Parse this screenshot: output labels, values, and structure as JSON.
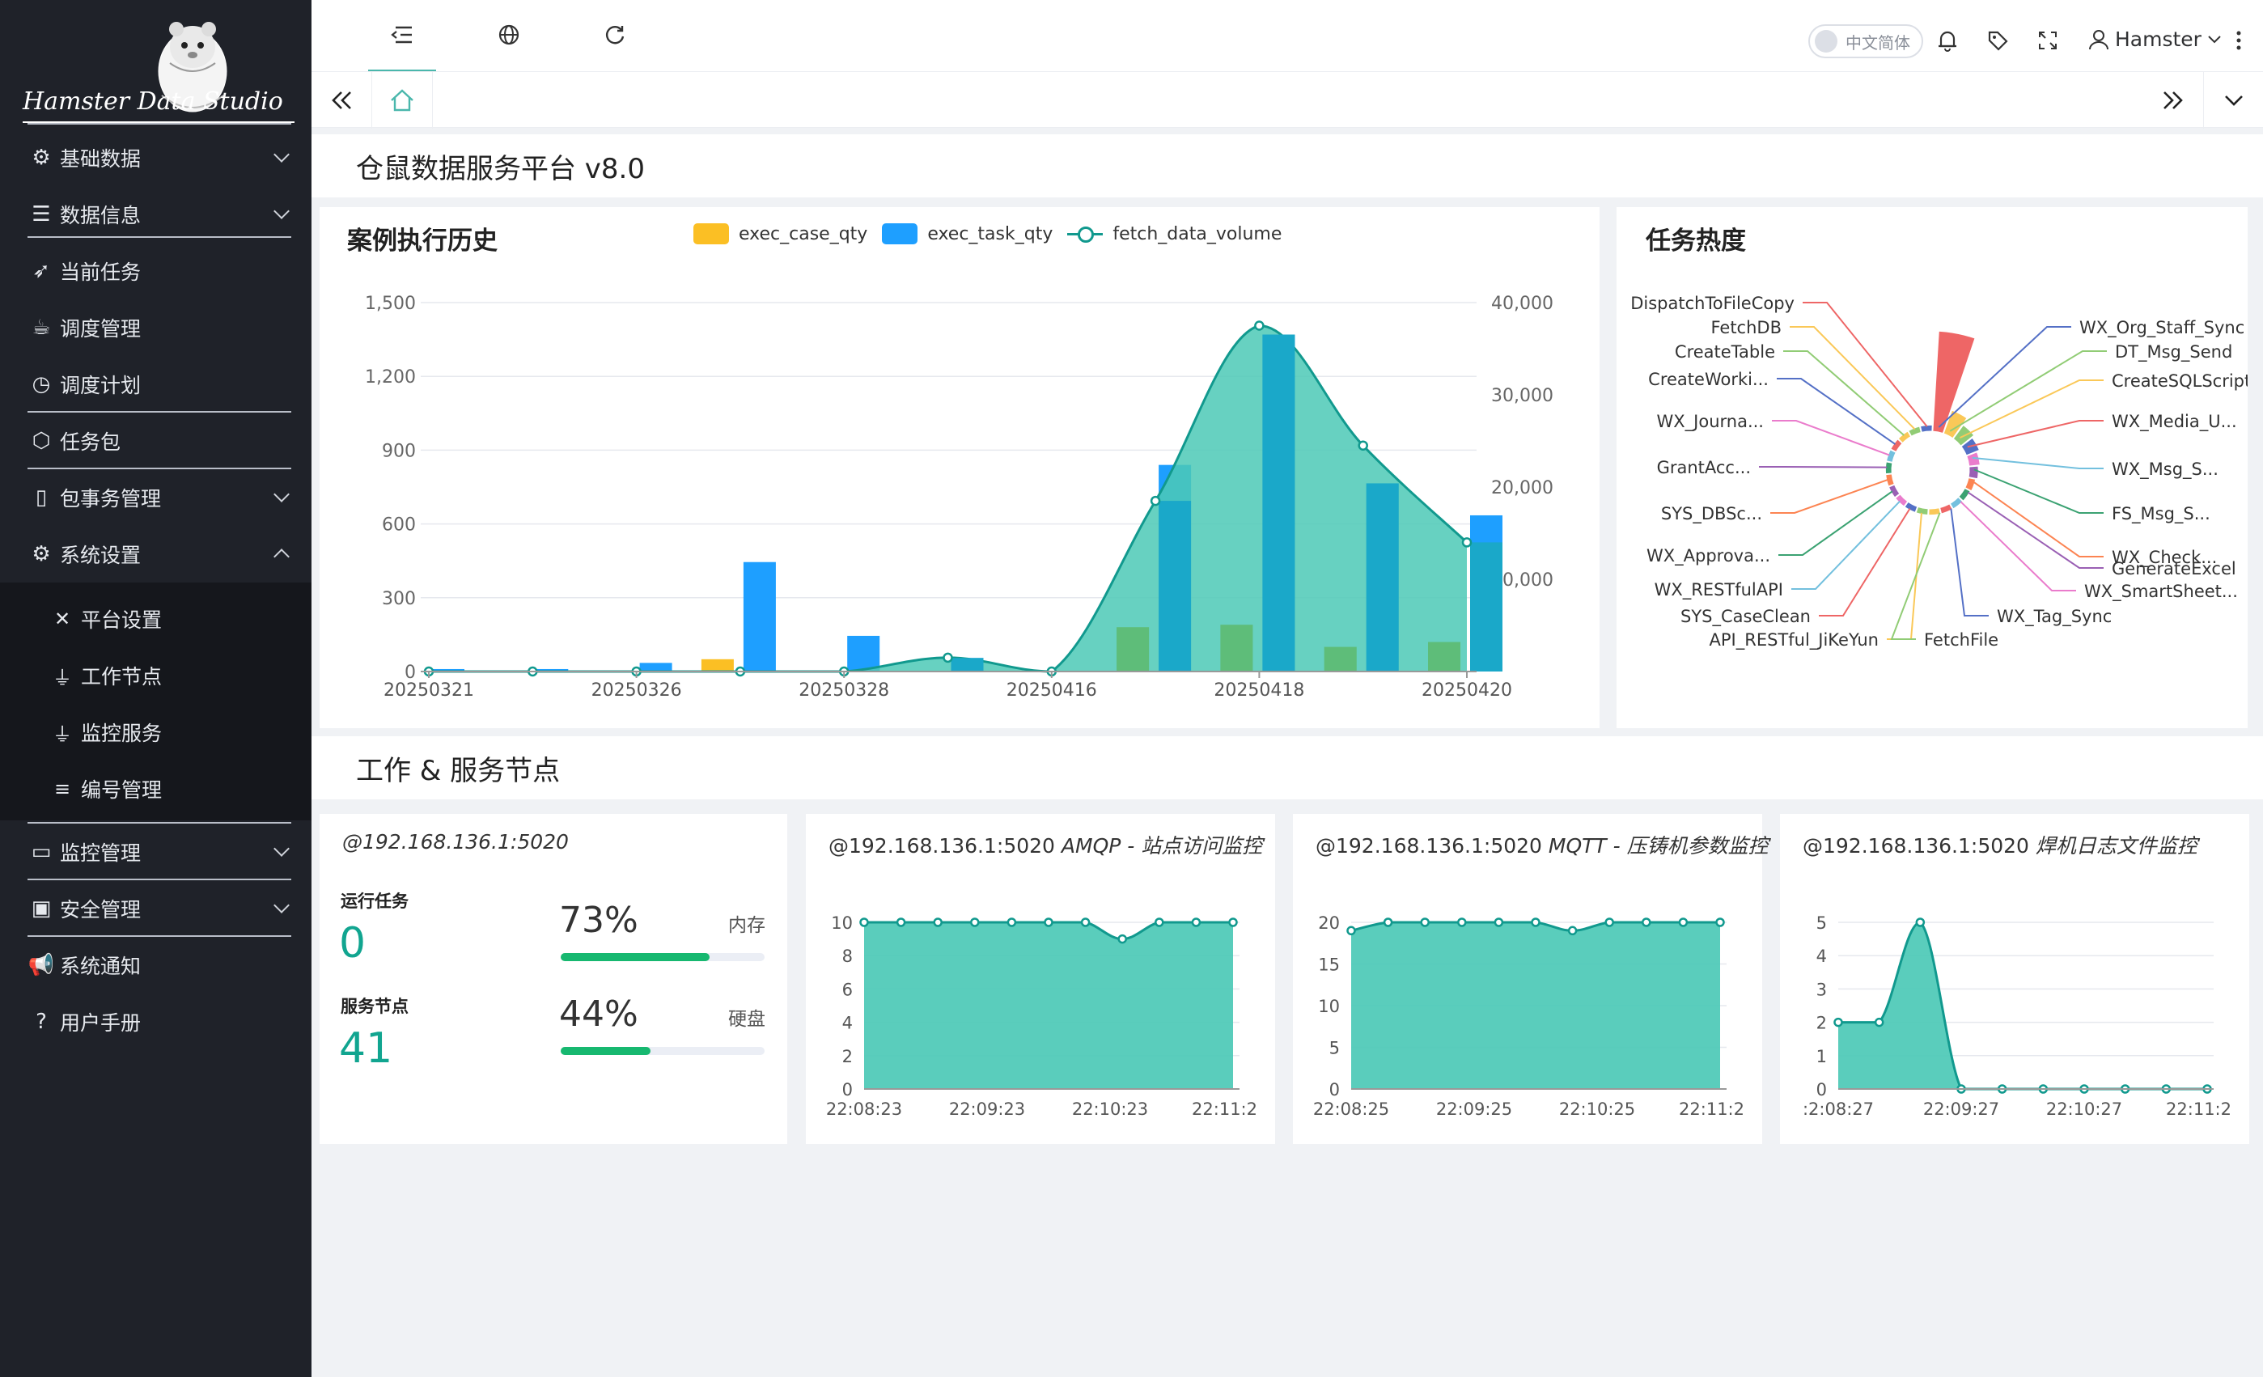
{
  "app": {
    "brand": "Hamster Data Studio",
    "accent": "#4ab7ac"
  },
  "sidebar": {
    "items": [
      {
        "label": "基础数据",
        "icon": "gear-icon",
        "expandable": true
      },
      {
        "label": "数据信息",
        "icon": "database-icon",
        "expandable": true
      },
      {
        "label": "当前任务",
        "icon": "rocket-icon",
        "expandable": false
      },
      {
        "label": "调度管理",
        "icon": "coffee-icon",
        "expandable": false
      },
      {
        "label": "调度计划",
        "icon": "clock-icon",
        "expandable": false
      },
      {
        "label": "任务包",
        "icon": "package-icon",
        "expandable": false
      },
      {
        "label": "包事务管理",
        "icon": "document-icon",
        "expandable": true
      },
      {
        "label": "系统设置",
        "icon": "gear-icon",
        "expandable": true,
        "expanded": true
      },
      {
        "label": "监控管理",
        "icon": "monitor-icon",
        "expandable": true
      },
      {
        "label": "安全管理",
        "icon": "id-card-icon",
        "expandable": true
      },
      {
        "label": "系统通知",
        "icon": "megaphone-icon",
        "expandable": false
      },
      {
        "label": "用户手册",
        "icon": "help-icon",
        "expandable": false
      }
    ],
    "subitems": [
      {
        "label": "平台设置",
        "icon": "tools-icon"
      },
      {
        "label": "工作节点",
        "icon": "plug-icon"
      },
      {
        "label": "监控服务",
        "icon": "plug-icon"
      },
      {
        "label": "编号管理",
        "icon": "list-icon"
      }
    ]
  },
  "topbar": {
    "lang_label": "中文简体",
    "user_name": "Hamster"
  },
  "page": {
    "title": "仓鼠数据服务平台 v8.0",
    "section2_title": "工作 & 服务节点"
  },
  "history_card": {
    "title": "案例执行历史",
    "legend": [
      "exec_case_qty",
      "exec_task_qty",
      "fetch_data_volume"
    ],
    "colors": {
      "case": "#fbbf24",
      "task": "#1e9fff",
      "volume_line": "#11998e",
      "volume_fill": "#4cc9b6",
      "case_over_area": "#5ebd79",
      "task_over_area": "#1aa8c9"
    }
  },
  "heat_card": {
    "title": "任务热度"
  },
  "nodes": [
    {
      "title_ip": "@192.168.136.1:5020",
      "title_desc": "",
      "running_label": "运行任务",
      "running_value": "0",
      "nodes_label": "服务节点",
      "nodes_value": "41",
      "mem_pct": "73%",
      "mem_label": "内存",
      "mem_fraction": 0.73,
      "disk_pct": "44%",
      "disk_label": "硬盘",
      "disk_fraction": 0.44
    },
    {
      "title_ip": "@192.168.136.1:5020",
      "title_desc": " AMQP - 站点访问监控"
    },
    {
      "title_ip": "@192.168.136.1:5020",
      "title_desc": " MQTT - 压铸机参数监控"
    },
    {
      "title_ip": "@192.168.136.1:5020",
      "title_desc": " 焊机日志文件监控"
    }
  ],
  "chart_data": [
    {
      "type": "bar",
      "title": "案例执行历史",
      "x_tick_labels": [
        "20250321",
        "20250326",
        "20250328",
        "20250416",
        "20250418",
        "20250420"
      ],
      "y_left_ticks": [
        "0",
        "300",
        "600",
        "900",
        "1,200",
        "1,500"
      ],
      "y_right_ticks": [
        "0",
        "10,000",
        "20,000",
        "30,000",
        "40,000"
      ],
      "ylim_left": [
        0,
        1500
      ],
      "ylim_right": [
        0,
        40000
      ],
      "slots": 11,
      "series": [
        {
          "name": "exec_case_qty",
          "type": "bar",
          "axis": "left",
          "values": [
            0,
            0,
            0,
            50,
            0,
            0,
            0,
            180,
            190,
            100,
            120
          ]
        },
        {
          "name": "exec_task_qty",
          "type": "bar",
          "axis": "left",
          "values": [
            10,
            10,
            35,
            445,
            145,
            55,
            0,
            840,
            1370,
            765,
            635
          ]
        },
        {
          "name": "fetch_data_volume",
          "type": "line",
          "axis": "right",
          "smooth": true,
          "area": true,
          "values": [
            0,
            0,
            0,
            0,
            0,
            1500,
            0,
            18500,
            37500,
            24500,
            14000
          ]
        }
      ]
    },
    {
      "type": "pie",
      "title": "任务热度",
      "subtype": "nightingale-rose",
      "labels": [
        "DispatchToFileCopy",
        "FetchDB",
        "CreateTable",
        "CreateWorki...",
        "WX_Journa...",
        "GrantAcc...",
        "SYS_DBSc...",
        "WX_Approva...",
        "WX_RESTfulAPI",
        "SYS_CaseClean",
        "API_RESTful_JiKeYun",
        "FetchFile",
        "WX_Tag_Sync",
        "WX_SmartSheet...",
        "GenerateExcel",
        "WX_Check...",
        "FS_Msg_S...",
        "WX_Msg_S...",
        "WX_Media_U...",
        "CreateSQLScript",
        "DT_Msg_Send",
        "WX_Org_Staff_Sync"
      ],
      "values": [
        100,
        22,
        14,
        11,
        8,
        6,
        4,
        3,
        3,
        3,
        3,
        3,
        3,
        3,
        3,
        3,
        3,
        3,
        3,
        3,
        3,
        3
      ],
      "colors": [
        "#ee6666",
        "#fac858",
        "#91cc75",
        "#5470c6",
        "#ea7ccc",
        "#9a60b4",
        "#fc8452",
        "#3ba272",
        "#73c0de",
        "#ee6666",
        "#fac858",
        "#91cc75",
        "#5470c6",
        "#ea7ccc",
        "#9a60b4",
        "#fc8452",
        "#3ba272",
        "#73c0de",
        "#ee6666",
        "#fac858",
        "#91cc75",
        "#5470c6"
      ]
    },
    {
      "type": "area",
      "title": "@192.168.136.1:5020 AMQP - 站点访问监控",
      "x_tick_labels": [
        "22:08:23",
        "22:09:23",
        "22:10:23",
        "22:11:2"
      ],
      "y_ticks": [
        "0",
        "2",
        "4",
        "6",
        "8",
        "10"
      ],
      "ylim": [
        0,
        10
      ],
      "values": [
        10,
        10,
        10,
        10,
        10,
        10,
        10,
        9,
        10,
        10,
        10
      ]
    },
    {
      "type": "area",
      "title": "@192.168.136.1:5020 MQTT - 压铸机参数监控",
      "x_tick_labels": [
        "22:08:25",
        "22:09:25",
        "22:10:25",
        "22:11:2"
      ],
      "y_ticks": [
        "0",
        "5",
        "10",
        "15",
        "20"
      ],
      "ylim": [
        0,
        20
      ],
      "values": [
        19,
        20,
        20,
        20,
        20,
        20,
        19,
        20,
        20,
        20,
        20
      ]
    },
    {
      "type": "area",
      "title": "@192.168.136.1:5020 焊机日志文件监控",
      "x_tick_labels": [
        ":2:08:27",
        "22:09:27",
        "22:10:27",
        "22:11:2"
      ],
      "y_ticks": [
        "0",
        "1",
        "2",
        "3",
        "4",
        "5"
      ],
      "ylim": [
        0,
        5
      ],
      "values": [
        2,
        2,
        5,
        0,
        0,
        0,
        0,
        0,
        0,
        0
      ]
    }
  ]
}
